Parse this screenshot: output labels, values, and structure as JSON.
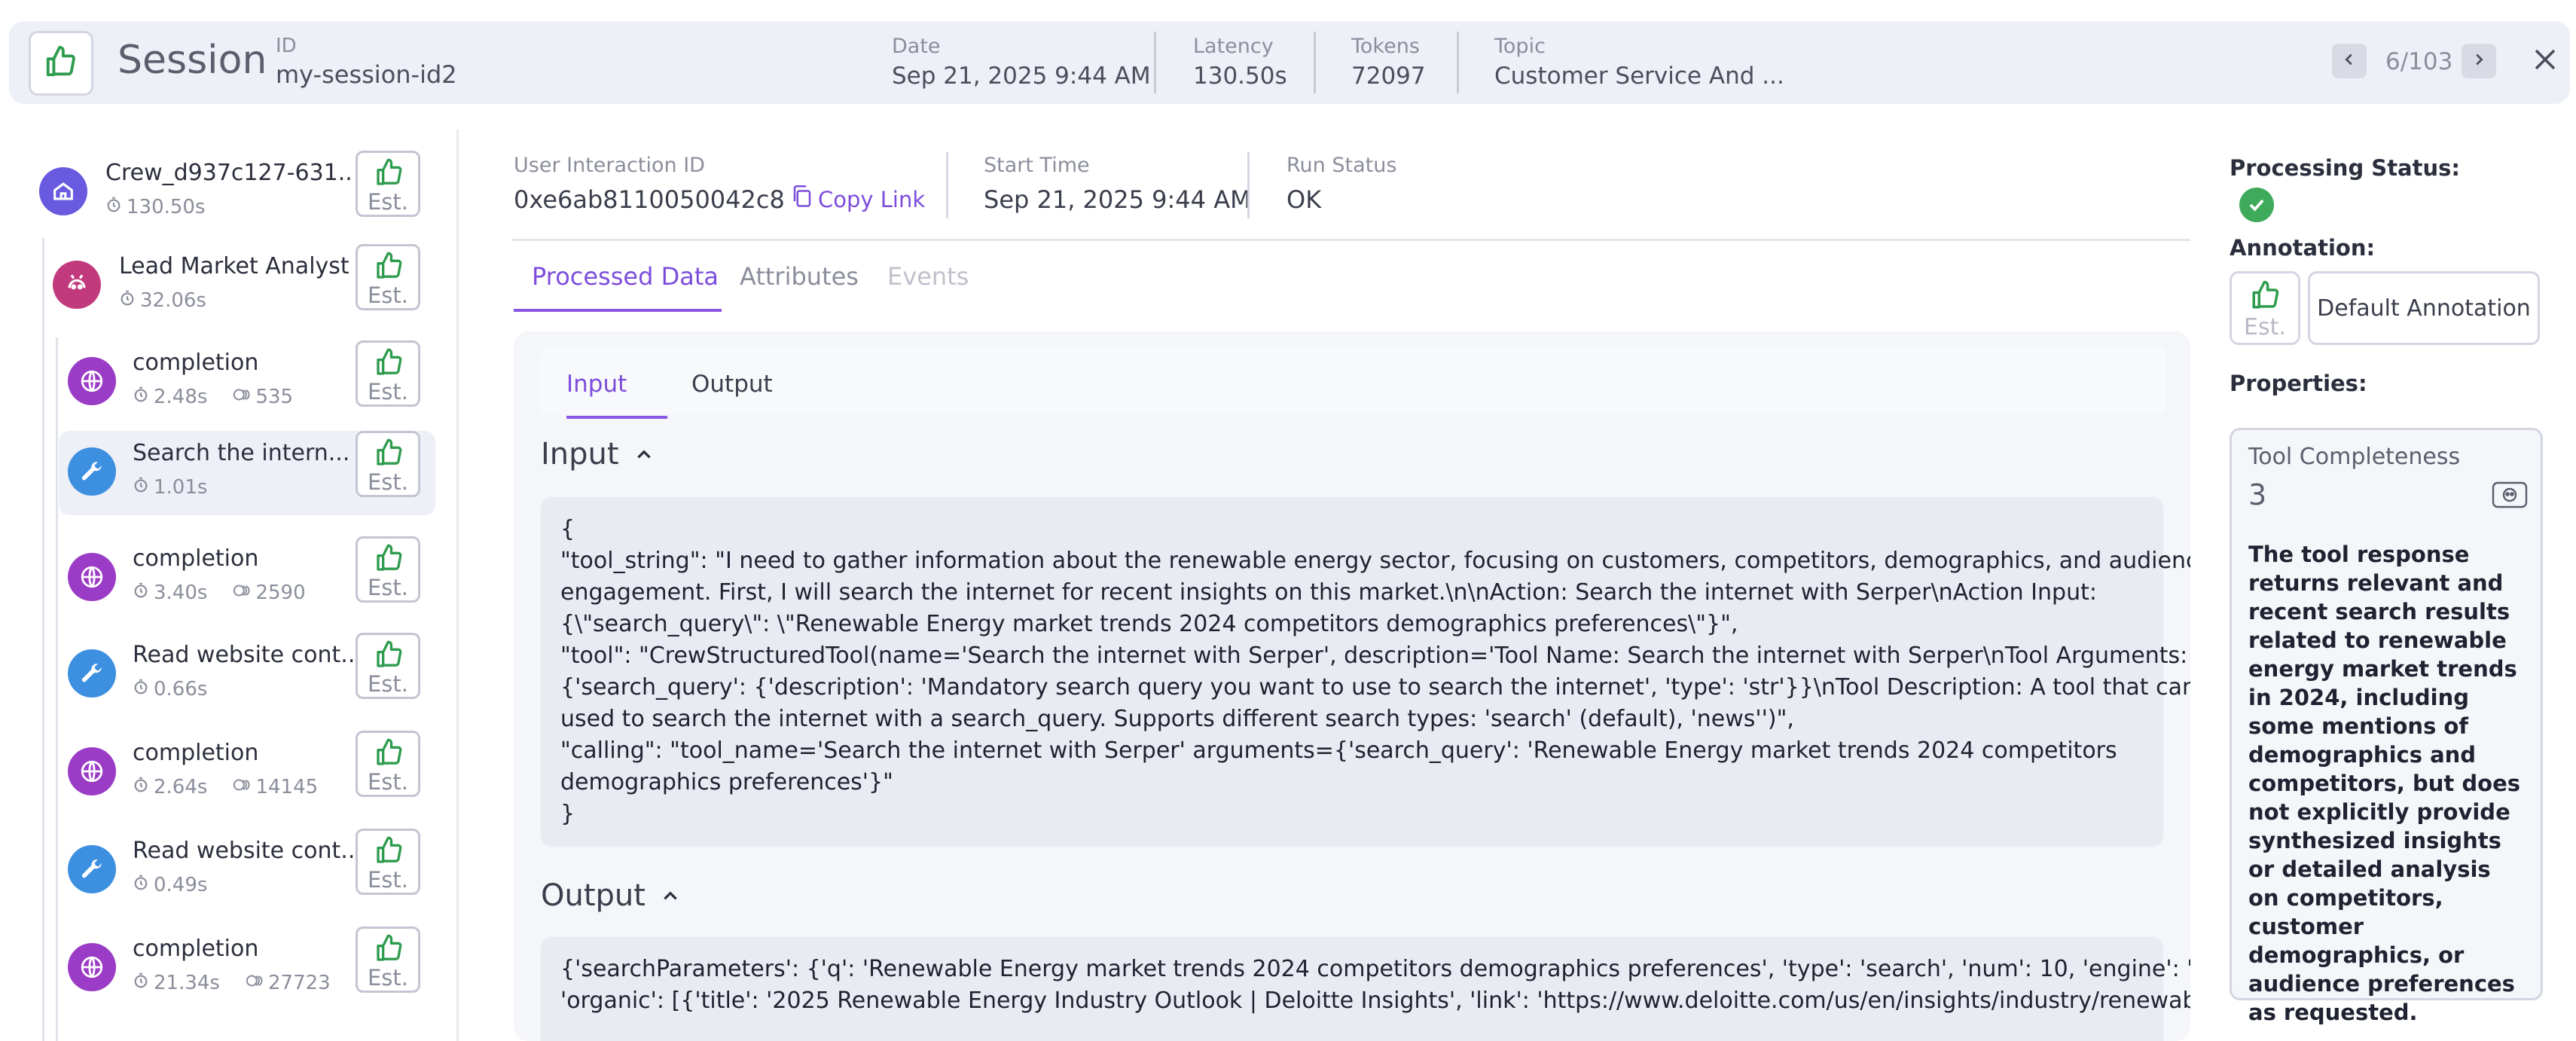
{
  "header": {
    "title": "Session",
    "id_label": "ID",
    "id_value": "my-session-id2",
    "stats": [
      {
        "label": "Date",
        "value": "Sep 21, 2025 9:44 AM"
      },
      {
        "label": "Latency",
        "value": "130.50s"
      },
      {
        "label": "Tokens",
        "value": "72097"
      },
      {
        "label": "Topic",
        "value": "Customer Service And ..."
      }
    ],
    "pager": "6/103"
  },
  "tree": [
    {
      "name": "Crew_d937c127-631...",
      "latency": "130.50s",
      "tokens": "",
      "icon": "crew-icon",
      "color": "#6a5ae0",
      "est": "Est."
    },
    {
      "name": "Lead Market Analyst",
      "latency": "32.06s",
      "tokens": "",
      "icon": "agent-icon",
      "color": "#c23a7e",
      "est": "Est."
    },
    {
      "name": "completion",
      "latency": "2.48s",
      "tokens": "535",
      "icon": "globe-icon",
      "color": "#9b3cc6",
      "est": "Est."
    },
    {
      "name": "Search the intern...",
      "latency": "1.01s",
      "tokens": "",
      "icon": "wrench-icon",
      "color": "#3d8fe0",
      "est": "Est."
    },
    {
      "name": "completion",
      "latency": "3.40s",
      "tokens": "2590",
      "icon": "globe-icon",
      "color": "#9b3cc6",
      "est": "Est."
    },
    {
      "name": "Read website cont...",
      "latency": "0.66s",
      "tokens": "",
      "icon": "wrench-icon",
      "color": "#3d8fe0",
      "est": "Est."
    },
    {
      "name": "completion",
      "latency": "2.64s",
      "tokens": "14145",
      "icon": "globe-icon",
      "color": "#9b3cc6",
      "est": "Est."
    },
    {
      "name": "Read website cont...",
      "latency": "0.49s",
      "tokens": "",
      "icon": "wrench-icon",
      "color": "#3d8fe0",
      "est": "Est."
    },
    {
      "name": "completion",
      "latency": "21.34s",
      "tokens": "27723",
      "icon": "globe-icon",
      "color": "#9b3cc6",
      "est": "Est."
    }
  ],
  "meta": {
    "interaction_label": "User Interaction ID",
    "interaction_value": "0xe6ab8110050042c8",
    "copy_link": "Copy Link",
    "start_label": "Start Time",
    "start_value": "Sep 21, 2025 9:44 AM",
    "status_label": "Run Status",
    "status_value": "OK"
  },
  "tabs": {
    "processed": "Processed Data",
    "attributes": "Attributes",
    "events": "Events"
  },
  "subtabs": {
    "input": "Input",
    "output": "Output"
  },
  "input_section": {
    "heading": "Input",
    "lines": [
      "{",
      "\"tool_string\": \"I need to gather information about the renewable energy sector, focusing on customers, competitors, demographics, and audience",
      "engagement. First, I will search the internet for recent insights on this market.\\n\\nAction: Search the internet with Serper\\nAction Input:",
      "{\\\"search_query\\\": \\\"Renewable Energy market trends 2024 competitors demographics preferences\\\"}\",",
      "\"tool\": \"CrewStructuredTool(name='Search the internet with Serper', description='Tool Name: Search the internet with Serper\\nTool Arguments:",
      "{'search_query': {'description': 'Mandatory search query you want to use to search the internet', 'type': 'str'}}\\nTool Description: A tool that can be",
      "used to search the internet with a search_query. Supports different search types: 'search' (default), 'news'')\",",
      "\"calling\": \"tool_name='Search the internet with Serper' arguments={'search_query': 'Renewable Energy market trends 2024 competitors",
      "demographics preferences'}\"",
      "}"
    ]
  },
  "output_section": {
    "heading": "Output",
    "lines": [
      "{'searchParameters': {'q': 'Renewable Energy market trends 2024 competitors demographics preferences', 'type': 'search', 'num': 10, 'engine': 'google'},",
      "'organic': [{'title': '2025 Renewable Energy Industry Outlook | Deloitte Insights', 'link': 'https://www.deloitte.com/us/en/insights/industry/renewable-"
    ]
  },
  "right": {
    "processing_label": "Processing Status:",
    "annotation_label": "Annotation:",
    "annotation_est": "Est.",
    "default_annotation": "Default Annotation",
    "properties_label": "Properties:",
    "property": {
      "name": "Tool Completeness",
      "score": "3",
      "description": "The tool response returns relevant and recent search results related to renewable energy market trends in 2024, including some mentions of demographics and competitors, but does not explicitly provide synthesized insights or detailed analysis on competitors, customer demographics, or audience preferences as requested."
    }
  },
  "colors": {
    "accent": "#7c4ddc",
    "thumb_green": "#2e9c4e",
    "success": "#3faa5b"
  }
}
